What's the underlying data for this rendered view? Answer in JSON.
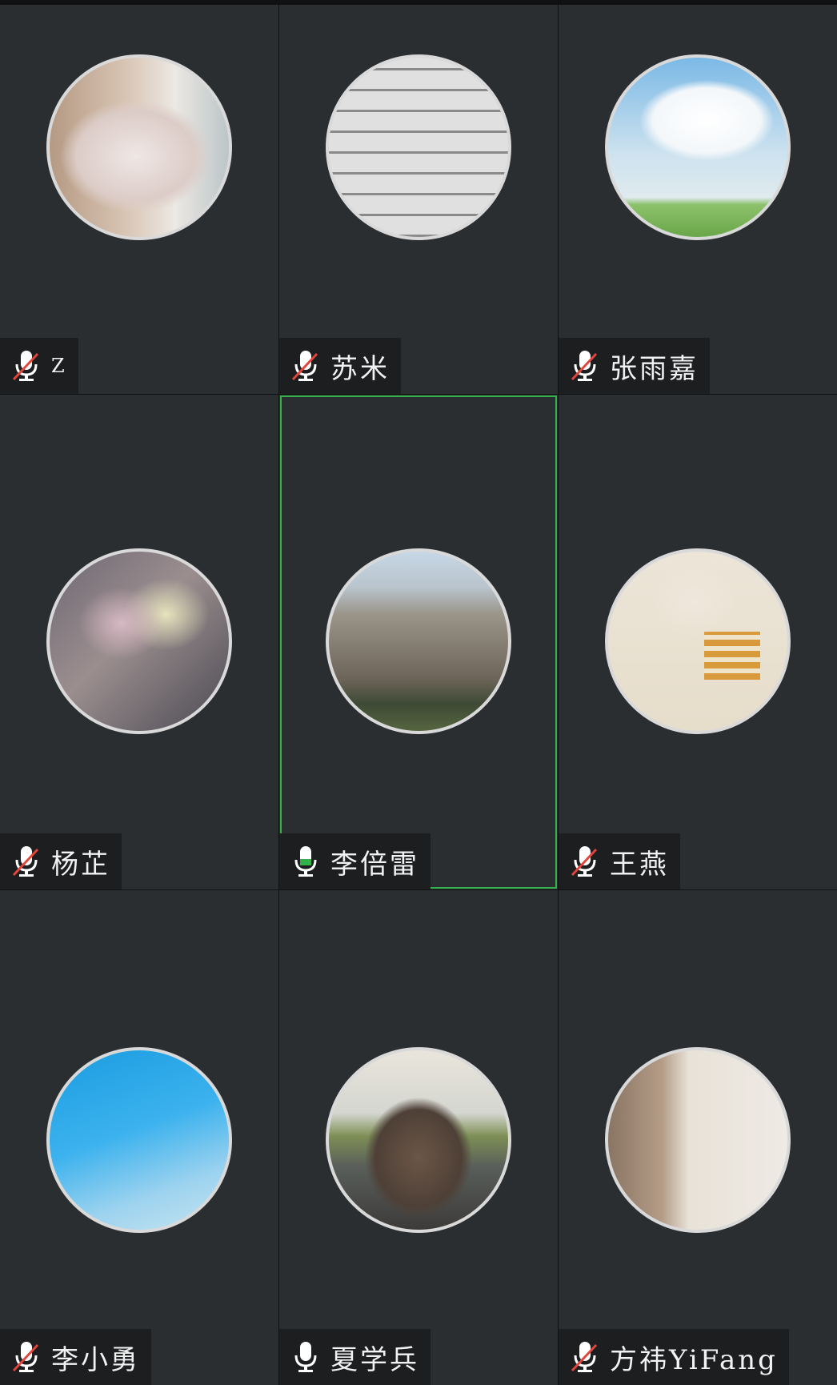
{
  "participants": [
    {
      "name": "Z",
      "mic": "muted",
      "avatar": "cat-photo"
    },
    {
      "name": "苏米",
      "mic": "muted",
      "avatar": "library-photo"
    },
    {
      "name": "张雨嘉",
      "mic": "muted",
      "avatar": "sky-field-photo"
    },
    {
      "name": "杨芷",
      "mic": "muted",
      "avatar": "flower-painting"
    },
    {
      "name": "李倍雷",
      "mic": "active",
      "avatar": "building-photo",
      "speaking": true
    },
    {
      "name": "王燕",
      "mic": "muted",
      "avatar": "baby-painting"
    },
    {
      "name": "李小勇",
      "mic": "muted",
      "avatar": "blue-sky-photo"
    },
    {
      "name": "夏学兵",
      "mic": "active",
      "avatar": "dog-photo"
    },
    {
      "name": "方祎YiFang",
      "mic": "muted",
      "avatar": "portrait-photo"
    }
  ],
  "colors": {
    "tile_bg": "#2b2e31",
    "name_tag_bg": "#1c1e20",
    "active_border": "#33b24a",
    "muted_slash": "#e2453c",
    "mic_white": "#ffffff"
  }
}
